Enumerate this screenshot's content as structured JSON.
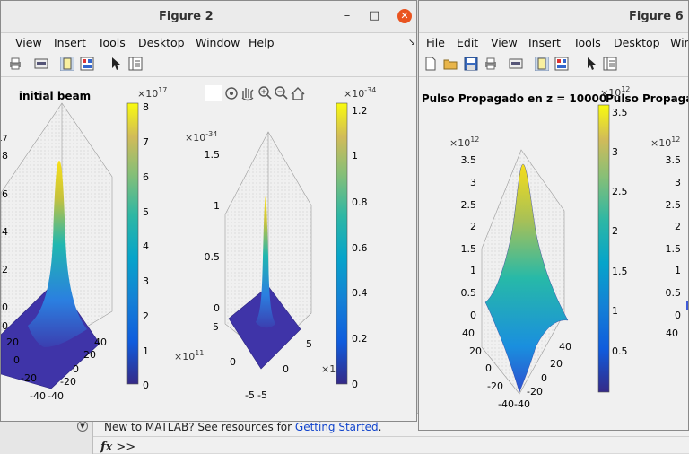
{
  "matlab": {
    "new_to_text": "New to MATLAB? See resources for ",
    "getting_started_link": "Getting Started",
    "period": ".",
    "fx": "fx",
    "prompt": ">>"
  },
  "figure2": {
    "title": "Figure 2",
    "menu": [
      "View",
      "Insert",
      "Tools",
      "Desktop",
      "Window",
      "Help"
    ],
    "axes1": {
      "title": "initial beam",
      "z_exponent_label": "×10",
      "z_exponent": "17",
      "z_exponent_partial": "17",
      "z_ticks": [
        "8",
        "6",
        "4",
        "2",
        "0"
      ],
      "x_ticks": [
        "40",
        "20",
        "0",
        "-20",
        "-40"
      ],
      "y_ticks": [
        "40",
        "20",
        "0",
        "-20",
        "-40"
      ],
      "left_tick_partial": "40",
      "colorbar": {
        "exponent_label": "×10",
        "exponent": "17",
        "ticks": [
          "8",
          "7",
          "6",
          "5",
          "4",
          "3",
          "2",
          "1",
          "0"
        ]
      }
    },
    "axes2": {
      "z_exponent_label": "×10",
      "z_exponent": "-34",
      "z_ticks": [
        "1.5",
        "1",
        "0.5",
        "0"
      ],
      "y_ticks": [
        "5",
        "0",
        "-5"
      ],
      "x_ticks": [
        "5",
        "0",
        "-5"
      ],
      "x_exponent_label": "×10",
      "x_exponent": "11",
      "partial_label": "×1",
      "colorbar": {
        "exponent_label": "×10",
        "exponent": "-34",
        "ticks": [
          "1.2",
          "1",
          "0.8",
          "0.6",
          "0.4",
          "0.2",
          "0"
        ]
      }
    }
  },
  "figure6": {
    "title": "Figure 6",
    "menu": [
      "File",
      "Edit",
      "View",
      "Insert",
      "Tools",
      "Desktop",
      "Wind"
    ],
    "axes1": {
      "title": "Pulso Propagado en z = 10000",
      "z_exponent_label": "×10",
      "z_exponent": "12",
      "z_ticks": [
        "3.5",
        "3",
        "2.5",
        "2",
        "1.5",
        "1",
        "0.5",
        "0"
      ],
      "x_ticks": [
        "40",
        "20",
        "0",
        "-20",
        "-40"
      ],
      "y_ticks": [
        "40",
        "20",
        "0",
        "-20",
        "-40"
      ],
      "colorbar": {
        "exponent_label": "×10",
        "exponent": "12",
        "ticks": [
          "3.5",
          "3",
          "2.5",
          "2",
          "1.5",
          "1",
          "0.5"
        ]
      }
    },
    "axes2": {
      "title_partial": "Pulso Propaga",
      "z_exponent_label": "×10",
      "z_exponent": "12",
      "z_ticks": [
        "3.5",
        "3",
        "2.5",
        "2",
        "1.5",
        "1",
        "0.5",
        "0"
      ],
      "y_tick_partial": "40"
    }
  },
  "colors": {
    "parula_low": "#352a87",
    "parula_mid": "#21b1a3",
    "parula_high": "#f9fb0e",
    "ubuntu_close": "#e95420",
    "link": "#1144cc"
  }
}
